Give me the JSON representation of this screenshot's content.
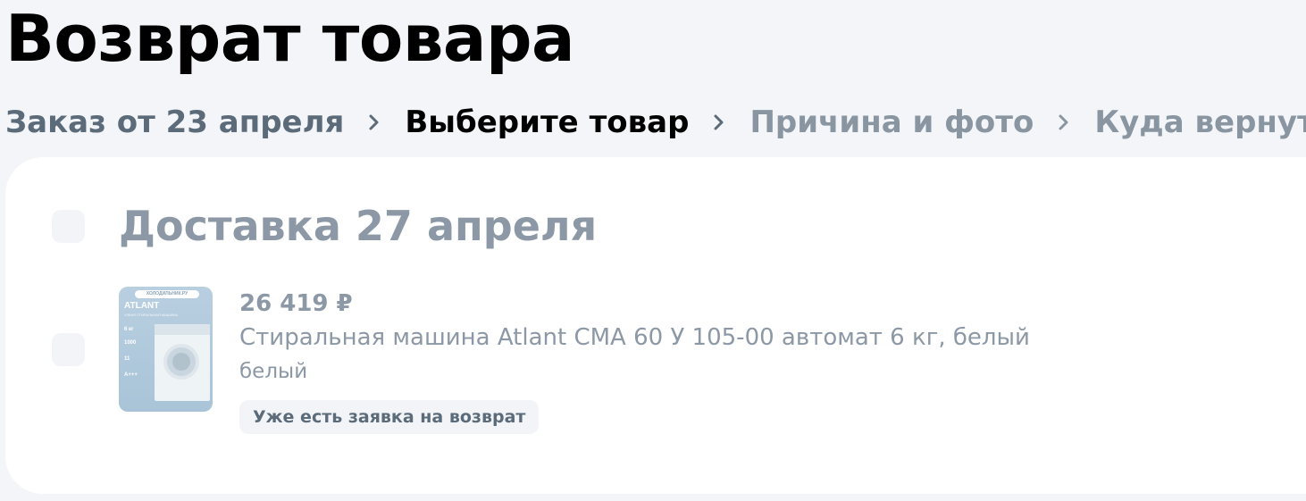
{
  "page": {
    "title": "Возврат товара"
  },
  "breadcrumb": {
    "steps": [
      {
        "label": "Заказ от 23 апреля",
        "state": "done"
      },
      {
        "label": "Выберите товар",
        "state": "current"
      },
      {
        "label": "Причина и фото",
        "state": "upcoming"
      },
      {
        "label": "Куда вернуть",
        "state": "upcoming"
      }
    ],
    "separator_icon": "chevron-right-icon"
  },
  "delivery": {
    "title": "Доставка 27 апреля",
    "items": [
      {
        "price": "26 419 ₽",
        "name": "Стиральная машина Atlant СМА 60 У 105-00 автомат 6 кг, белый",
        "color": "белый",
        "status_badge": "Уже есть заявка на возврат",
        "image": {
          "brand": "ATLANT",
          "store_strip": "ХОЛОДИЛЬНИК.РУ",
          "subtitle": "УЗКАЯ СТИРАЛЬНАЯ МАШИНА",
          "spec_weight": "6 кг",
          "spec_spin": "1000",
          "spec_programs": "11",
          "spec_energy": "A+++"
        }
      }
    ]
  },
  "colors": {
    "background": "#f4f5f9",
    "card": "#ffffff",
    "text_primary": "#000000",
    "text_done": "#5b6b79",
    "text_muted": "#8c98a5",
    "checkbox_bg": "#f2f4f8"
  }
}
